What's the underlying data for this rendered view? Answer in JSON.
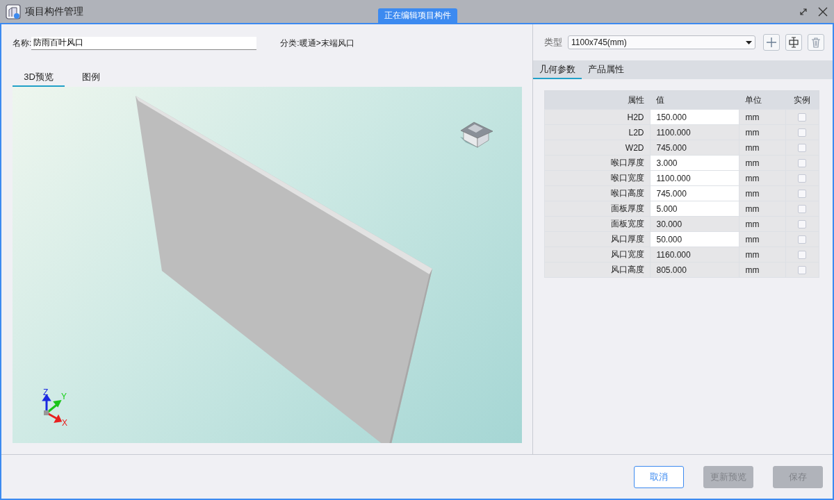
{
  "window": {
    "title": "项目构件管理",
    "badge": "正在编辑项目构件"
  },
  "left": {
    "name_label": "名称:",
    "name_value": "防雨百叶风口",
    "category_label": "分类:",
    "category_value": "暖通>末端风口",
    "tabs": [
      {
        "label": "3D预览",
        "selected": true
      },
      {
        "label": "图例",
        "selected": false
      }
    ],
    "axes": {
      "z": "Z",
      "y": "Y",
      "x": "X"
    }
  },
  "right": {
    "type_label": "类型",
    "type_value": "1100x745(mm)",
    "tabs": [
      {
        "label": "几何参数",
        "selected": true
      },
      {
        "label": "产品属性",
        "selected": false
      }
    ],
    "columns": [
      "属性",
      "值",
      "单位",
      "实例"
    ],
    "rows": [
      {
        "name": "H2D",
        "value": "150.000",
        "unit": "mm",
        "editable": true,
        "checked": false
      },
      {
        "name": "L2D",
        "value": "1100.000",
        "unit": "mm",
        "editable": false,
        "checked": false
      },
      {
        "name": "W2D",
        "value": "745.000",
        "unit": "mm",
        "editable": false,
        "checked": false
      },
      {
        "name": "喉口厚度",
        "value": "3.000",
        "unit": "mm",
        "editable": true,
        "checked": false
      },
      {
        "name": "喉口宽度",
        "value": "1100.000",
        "unit": "mm",
        "editable": true,
        "checked": false
      },
      {
        "name": "喉口高度",
        "value": "745.000",
        "unit": "mm",
        "editable": true,
        "checked": false
      },
      {
        "name": "面板厚度",
        "value": "5.000",
        "unit": "mm",
        "editable": true,
        "checked": false
      },
      {
        "name": "面板宽度",
        "value": "30.000",
        "unit": "mm",
        "editable": false,
        "checked": false
      },
      {
        "name": "风口厚度",
        "value": "50.000",
        "unit": "mm",
        "editable": true,
        "checked": false
      },
      {
        "name": "风口宽度",
        "value": "1160.000",
        "unit": "mm",
        "editable": false,
        "checked": false
      },
      {
        "name": "风口高度",
        "value": "805.000",
        "unit": "mm",
        "editable": false,
        "checked": false
      }
    ]
  },
  "buttons": [
    {
      "label": "取消",
      "disabled": false
    },
    {
      "label": "更新预览",
      "disabled": true
    },
    {
      "label": "保存",
      "disabled": true
    }
  ]
}
